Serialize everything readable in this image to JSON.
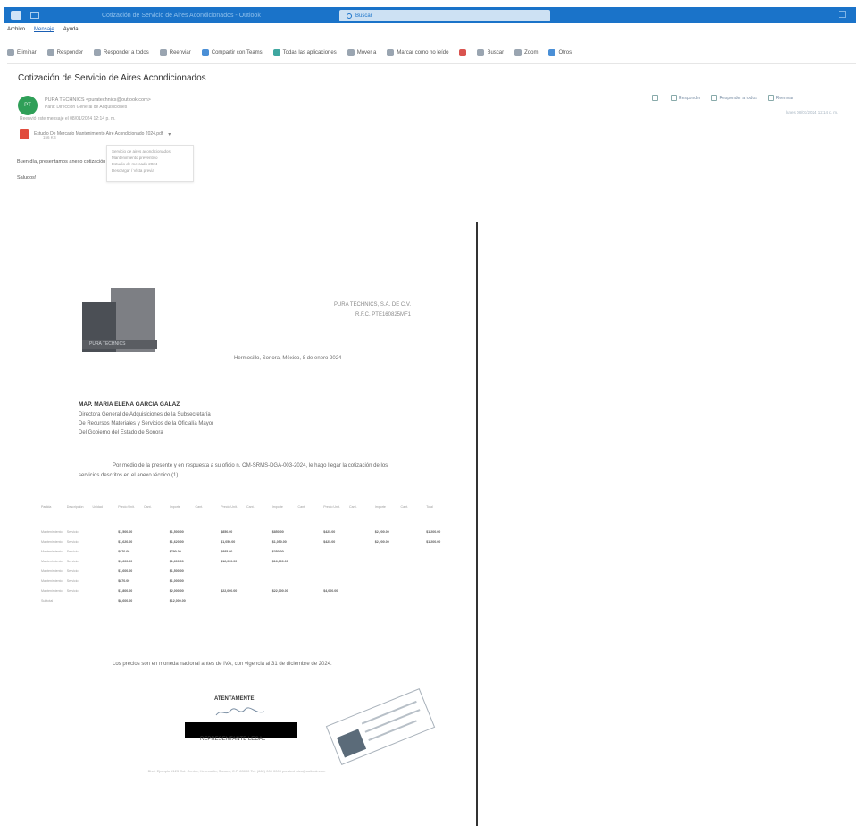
{
  "window": {
    "title": "Cotización de Servicio de Aires Acondicionados - Outlook",
    "search_placeholder": "Buscar"
  },
  "menu": [
    "Archivo",
    "Mensaje",
    "Ayuda"
  ],
  "ribbon": {
    "items": [
      "Eliminar",
      "Responder",
      "Responder a todos",
      "Reenviar",
      "Compartir con Teams",
      "Todas las aplicaciones",
      "Mover a",
      "Marcar como no leído",
      "Buscar",
      "Zoom",
      "Otros"
    ]
  },
  "email": {
    "subject": "Cotización de Servicio de Aires Acondicionados",
    "avatar_initials": "PT",
    "sender": "PURA TECHNICS <puratechnics@outlook.com>",
    "to": "Para: Dirección General de Adquisiciones",
    "forwarded": "Reenvió este mensaje el 08/01/2024 12:14 p. m.",
    "attachment_name": "Estudio De Mercado Mantenimiento Aire Acondicionado 2024.pdf",
    "attachment_size": "156 KB",
    "attachment_menu": [
      "Servicio de aires acondicionados",
      "Mantenimiento preventivo",
      "Estudio de mercado 2024",
      "Descargar / Vista previa"
    ],
    "body_line1": "Buen día, presentamos anexo cotización",
    "body_line2": "Saludos!",
    "actions": [
      "Responder",
      "Responder a todos",
      "Reenviar"
    ],
    "timestamp": "lunes 08/01/2024 12:14 p. m."
  },
  "document": {
    "logo_text": "PURA TECHNICS",
    "company_name": "PURA TECHNICS, S.A. DE C.V.",
    "company_rfc": "R.F.C. PTE160825MF1",
    "place_date": "Hermosillo, Sonora, México, 8 de enero 2024",
    "addressee_name": "MAP. MARIA ELENA GARCIA GALAZ",
    "addressee_lines": [
      "Directora General de Adquisiciones de la Subsecretaría",
      "De Recursos Materiales y Servicios de la Oficialía Mayor",
      "Del Gobierno del Estado de Sonora"
    ],
    "intro": "Por medio de la presente y en respuesta a su oficio n. OM-SRMS-DGA-003-2024, le hago llegar la cotización de los servicios descritos en el anexo técnico (1).",
    "table_headers": [
      "Partida",
      "Descripción",
      "Unidad",
      "Precio Unit.",
      "Cant.",
      "Importe",
      "Cant.",
      "Precio Unit.",
      "Cant.",
      "Importe",
      "Cant.",
      "Precio Unit.",
      "Cant.",
      "Importe",
      "Cant.",
      "Total"
    ],
    "table_rows": [
      [
        "Mantenimiento",
        "Servicio",
        "",
        "$1,500.00",
        "",
        "$1,500.00",
        "",
        "$850.00",
        "",
        "$850.00",
        "",
        "$425.00",
        "",
        "$2,200.00",
        "",
        "$1,200.00"
      ],
      [
        "Mantenimiento",
        "Servicio",
        "",
        "$1,620.00",
        "",
        "$1,620.00",
        "",
        "$1,050.00",
        "",
        "$1,050.00",
        "",
        "$425.00",
        "",
        "$2,200.00",
        "",
        "$1,200.00"
      ],
      [
        "Mantenimiento",
        "Servicio",
        "",
        "$870.00",
        "",
        "$790.00",
        "",
        "$885.00",
        "",
        "$350.00",
        "",
        "",
        "",
        "",
        "",
        ""
      ],
      [
        "Mantenimiento",
        "Servicio",
        "",
        "$1,600.00",
        "",
        "$1,600.00",
        "",
        "$12,000.00",
        "",
        "$16,000.00",
        "",
        "",
        "",
        "",
        "",
        ""
      ],
      [
        "Mantenimiento",
        "Servicio",
        "",
        "$1,600.00",
        "",
        "$1,500.00",
        "",
        "",
        "",
        "",
        "",
        "",
        "",
        "",
        "",
        ""
      ],
      [
        "Mantenimiento",
        "Servicio",
        "",
        "$870.00",
        "",
        "$1,000.00",
        "",
        "",
        "",
        "",
        "",
        "",
        "",
        "",
        "",
        ""
      ],
      [
        "Mantenimiento",
        "Servicio",
        "",
        "$1,800.00",
        "",
        "$2,000.00",
        "",
        "$22,000.00",
        "",
        "$22,000.00",
        "",
        "$4,000.00",
        "",
        "",
        "",
        ""
      ],
      [
        "Subtotal",
        "",
        "",
        "$8,600.00",
        "",
        "$12,000.00",
        "",
        "",
        "",
        "",
        "",
        "",
        "",
        "",
        "",
        ""
      ]
    ],
    "prices_note": "Los precios son en moneda nacional antes de IVA, con vigencia al 31 de diciembre de 2024.",
    "closing": "ATENTAMENTE",
    "rep_legal": "REPRESENTANTE LEGAL",
    "stamp_text": "PURA TECHNICS, S.A. DE C.V.",
    "footer": "Blvd. Ejemplo #123 Col. Centro, Hermosillo, Sonora, C.P. 83000 Tel. (662) 000 0000 puratechnics@outlook.com"
  }
}
